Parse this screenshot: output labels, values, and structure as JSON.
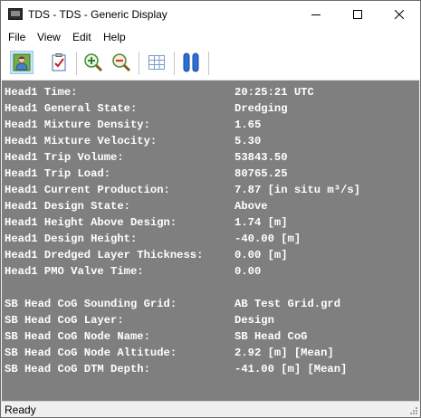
{
  "window": {
    "title": "TDS - TDS  - Generic Display"
  },
  "menu": {
    "file": "File",
    "view": "View",
    "edit": "Edit",
    "help": "Help"
  },
  "toolbar": {
    "buttons": [
      {
        "icon": "user-profile-icon",
        "pressed": true
      },
      {
        "icon": "checklist-icon",
        "pressed": false
      },
      {
        "icon": "zoom-in-icon",
        "pressed": false
      },
      {
        "icon": "zoom-out-icon",
        "pressed": false
      },
      {
        "icon": "grid-icon",
        "pressed": false
      },
      {
        "icon": "pause-icon",
        "pressed": false
      }
    ]
  },
  "display": {
    "background": "#7f7f7f",
    "text_color": "#ffffff",
    "head_rows": [
      {
        "label": "Head1 Time:",
        "value": "20:25:21 UTC"
      },
      {
        "label": "Head1 General State:",
        "value": "Dredging"
      },
      {
        "label": "Head1 Mixture Density:",
        "value": "1.65"
      },
      {
        "label": "Head1 Mixture Velocity:",
        "value": "5.30"
      },
      {
        "label": "Head1 Trip Volume:",
        "value": "53843.50"
      },
      {
        "label": "Head1 Trip Load:",
        "value": "80765.25"
      },
      {
        "label": "Head1 Current Production:",
        "value": "7.87 [in situ m³/s]"
      },
      {
        "label": "Head1 Design State:",
        "value": "Above"
      },
      {
        "label": "Head1 Height Above Design:",
        "value": "1.74 [m]"
      },
      {
        "label": "Head1 Design Height:",
        "value": "-40.00 [m]"
      },
      {
        "label": "Head1 Dredged Layer Thickness:",
        "value": "0.00 [m]"
      },
      {
        "label": "Head1 PMO Valve Time:",
        "value": "0.00"
      }
    ],
    "cog_rows": [
      {
        "label": "SB Head CoG Sounding Grid:",
        "value": "AB Test Grid.grd"
      },
      {
        "label": "SB Head CoG Layer:",
        "value": "Design"
      },
      {
        "label": "SB Head CoG Node Name:",
        "value": "SB Head CoG"
      },
      {
        "label": "SB Head CoG Node Altitude:",
        "value": "2.92 [m] [Mean]"
      },
      {
        "label": "SB Head CoG DTM Depth:",
        "value": "-41.00 [m] [Mean]"
      }
    ]
  },
  "status": {
    "text": "Ready"
  }
}
